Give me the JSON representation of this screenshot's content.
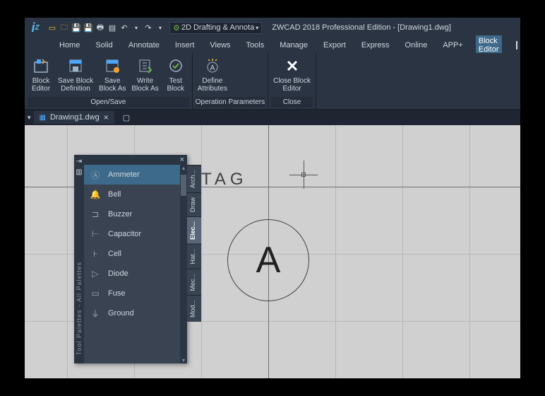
{
  "titlebar": {
    "workspace": "2D Drafting & Annota",
    "app_title": "ZWCAD 2018 Professional Edition - [Drawing1.dwg]"
  },
  "menubar": {
    "items": [
      "Home",
      "Solid",
      "Annotate",
      "Insert",
      "Views",
      "Tools",
      "Manage",
      "Export",
      "Express",
      "Online",
      "APP+",
      "Block Editor"
    ],
    "active": "Block Editor"
  },
  "ribbon": {
    "groups": [
      {
        "title": "Open/Save",
        "tools": [
          {
            "label": "Block\nEditor"
          },
          {
            "label": "Save Block\nDefinition"
          },
          {
            "label": "Save\nBlock As"
          },
          {
            "label": "Write\nBlock As"
          },
          {
            "label": "Test\nBlock"
          }
        ]
      },
      {
        "title": "Operation Parameters",
        "tools": [
          {
            "label": "Define\nAttributes"
          }
        ]
      },
      {
        "title": "Close",
        "tools": [
          {
            "label": "Close Block\nEditor"
          }
        ]
      }
    ]
  },
  "doctab": {
    "name": "Drawing1.dwg"
  },
  "canvas": {
    "tag_label": "TAG",
    "circle_letter": "A"
  },
  "palette": {
    "title": "Tool Palettes - All Palettes",
    "tabs": [
      "Arch...",
      "Draw",
      "Elec...",
      "Hat...",
      "Mec...",
      "Mod..."
    ],
    "active_tab": "Elec...",
    "items": [
      {
        "label": "Ammeter",
        "selected": true
      },
      {
        "label": "Bell"
      },
      {
        "label": "Buzzer"
      },
      {
        "label": "Capacitor"
      },
      {
        "label": "Cell"
      },
      {
        "label": "Diode"
      },
      {
        "label": "Fuse"
      },
      {
        "label": "Ground"
      }
    ]
  }
}
